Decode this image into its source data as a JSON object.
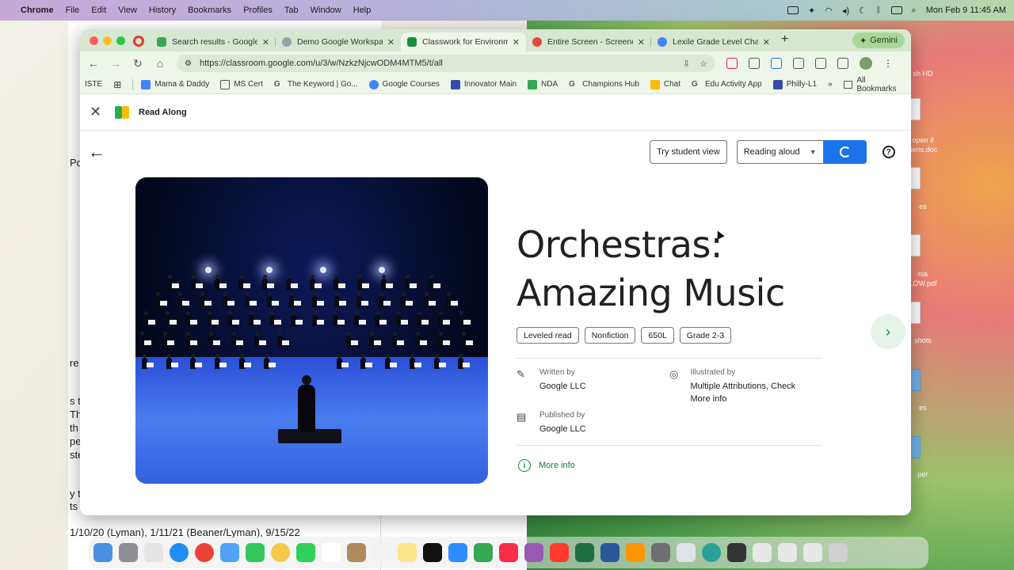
{
  "menubar": {
    "app": "Chrome",
    "items": [
      "File",
      "Edit",
      "View",
      "History",
      "Bookmarks",
      "Profiles",
      "Tab",
      "Window",
      "Help"
    ],
    "clock": "Mon Feb 9  11:45 AM"
  },
  "desktop": {
    "fragments": [
      "Pq",
      "re",
      "s t",
      "Th",
      "th",
      "pe",
      "ste",
      "y th",
      "ts s",
      "1/10/20 (Lyman), 1/11/21 (Beaner/Lyman), 9/15/22"
    ],
    "right_labels": [
      "sh HD",
      "open if",
      "pens.doc",
      "es",
      "nia",
      "LOW.pdf",
      "shots",
      "es",
      "per"
    ]
  },
  "browser": {
    "tabs": [
      {
        "label": "Search results - Google D",
        "color": "#34a853"
      },
      {
        "label": "Demo Google Workspace",
        "color": "#5f6368"
      },
      {
        "label": "Classwork for Environme",
        "color": "#1e8e3e"
      },
      {
        "label": "Entire Screen - Screenca",
        "color": "#e8453c"
      },
      {
        "label": "Lexile Grade Level Chart",
        "color": "#4285f4"
      }
    ],
    "gemini": "Gemini",
    "url": "https://classroom.google.com/u/3/w/NzkzNjcwODM4MTM5/t/all",
    "bookmarks": [
      "ISTE",
      "Mama & Daddy",
      "MS Cert",
      "The Keyword | Go...",
      "Google Courses",
      "Innovator Main",
      "NDA",
      "Champions Hub",
      "Chat",
      "Edu Activity App",
      "Philly-L1"
    ],
    "all_bookmarks": "All Bookmarks"
  },
  "readalong": {
    "title": "Read Along",
    "try_student_view": "Try student view",
    "reading_mode": "Reading aloud",
    "book": {
      "title": "Orchestras: Amazing Music",
      "chips": [
        "Leveled read",
        "Nonfiction",
        "650L",
        "Grade 2-3"
      ],
      "written_by_label": "Written by",
      "written_by": "Google LLC",
      "illustrated_by_label": "Illustrated by",
      "illustrated_by": "Multiple Attributions, Check More info",
      "published_by_label": "Published by",
      "published_by": "Google LLC",
      "more_info": "More info"
    }
  },
  "colors": {
    "accent_blue": "#1a73e8",
    "green": "#188038",
    "tab_strip": "#d7e7d2"
  }
}
